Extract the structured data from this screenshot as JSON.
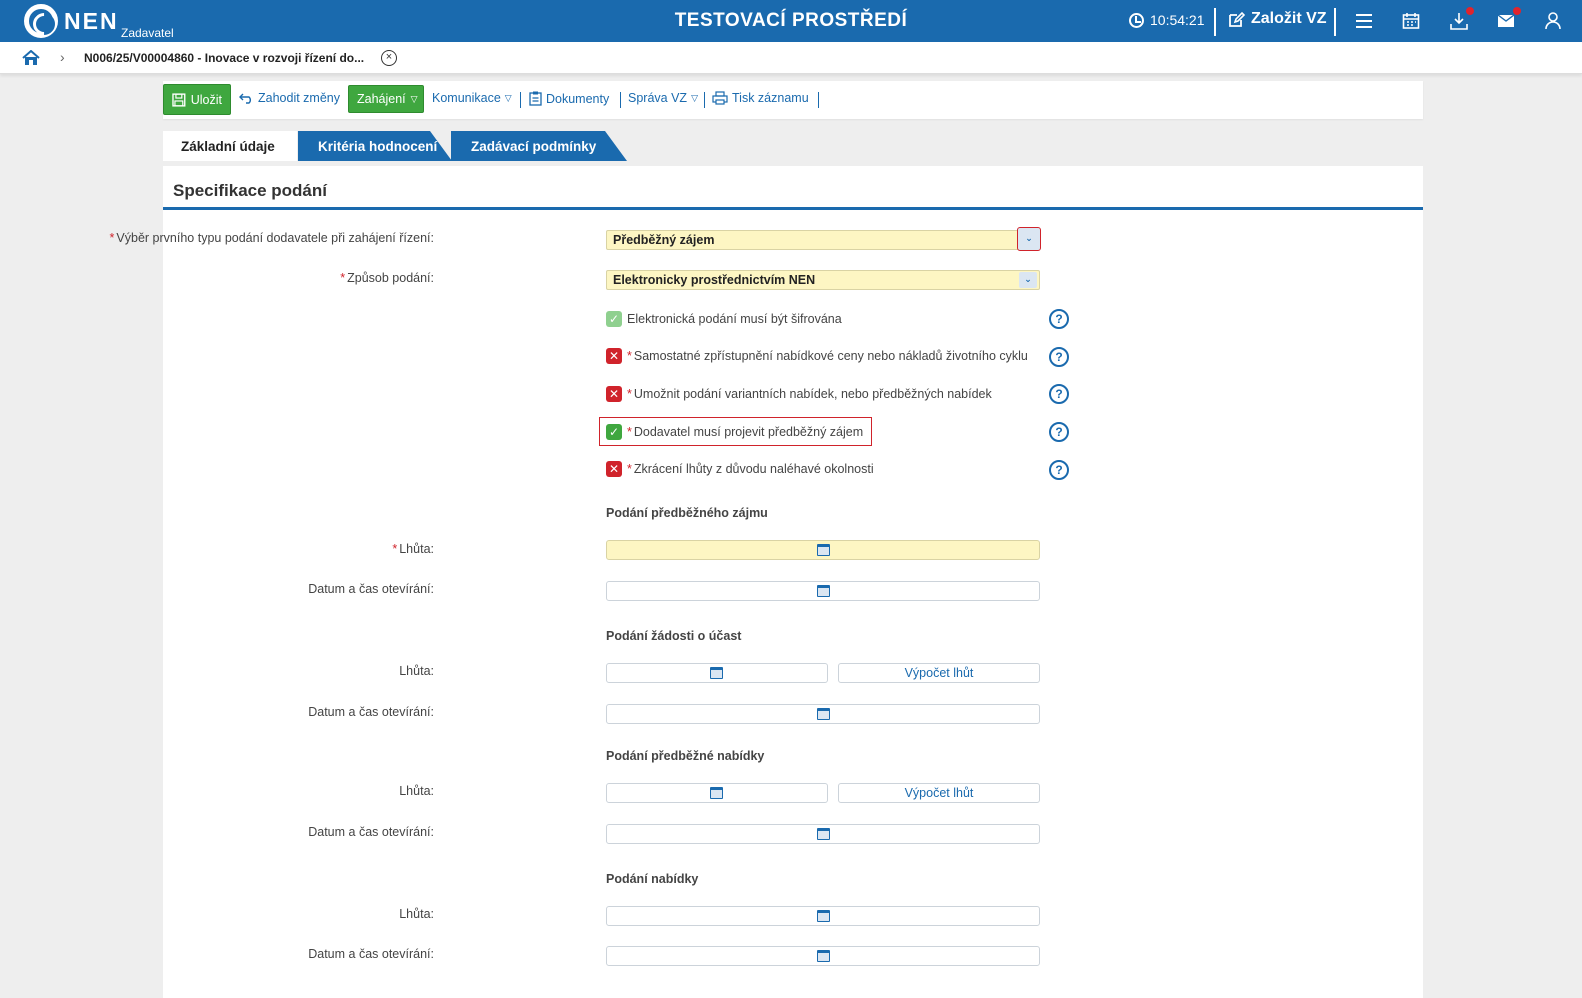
{
  "header": {
    "brand": "NEN",
    "brand_sub": "Zadavatel",
    "environment": "TESTOVACÍ PROSTŘEDÍ",
    "time": "10:54:21",
    "new_vz": "Založit VZ",
    "icons": [
      "menu-icon",
      "calendar-icon",
      "download-icon",
      "mail-icon",
      "user-icon"
    ],
    "colors": {
      "primary": "#1a6aae",
      "notify": "#e0242d"
    }
  },
  "breadcrumb": {
    "text": "N006/25/V00004860 - Inovace v rozvoji řízení do..."
  },
  "toolbar": {
    "save": "Uložit",
    "discard": "Zahodit změny",
    "start": "Zahájení",
    "communication": "Komunikace",
    "documents": "Dokumenty",
    "manage": "Správa VZ",
    "print": "Tisk záznamu",
    "colors": {
      "green": "#3fa73f"
    }
  },
  "tabs": [
    {
      "label": "Základní údaje",
      "active": true
    },
    {
      "label": "Kritéria hodnocení",
      "active": false
    },
    {
      "label": "Zadávací podmínky",
      "active": false
    }
  ],
  "panel": {
    "title": "Specifikace podání",
    "first_submission": {
      "label": "Výběr prvního typu podání dodavatele při zahájení řízení:",
      "value": "Předběžný zájem"
    },
    "method": {
      "label": "Způsob podání:",
      "value": "Elektronicky prostřednictvím NEN"
    },
    "checks": [
      {
        "label": "Elektronická podání musí být šifrována",
        "required": false,
        "checked": true
      },
      {
        "label": "Samostatné zpřístupnění nabídkové ceny nebo nákladů životního cyklu",
        "required": true,
        "checked": false
      },
      {
        "label": "Umožnit podání variantních nabídek, nebo předběžných nabídek",
        "required": true,
        "checked": false
      },
      {
        "label": "Dodavatel musí projevit předběžný zájem",
        "required": true,
        "checked": true
      },
      {
        "label": "Zkrácení lhůty z důvodu naléhavé okolnosti",
        "required": true,
        "checked": false
      }
    ],
    "sections": [
      {
        "title": "Podání předběžného zájmu",
        "deadline_label": "Lhůta:",
        "opening_label": "Datum a čas otevírání:"
      },
      {
        "title": "Podání žádosti o účast",
        "deadline_label": "Lhůta:",
        "opening_label": "Datum a čas otevírání:",
        "calc": "Výpočet lhůt"
      },
      {
        "title": "Podání předběžné nabídky",
        "deadline_label": "Lhůta:",
        "opening_label": "Datum a čas otevírání:",
        "calc": "Výpočet lhůt"
      },
      {
        "title": "Podání nabídky",
        "deadline_label": "Lhůta:",
        "opening_label": "Datum a čas otevírání:"
      }
    ],
    "required_mark": "*",
    "help_glyph": "?"
  }
}
